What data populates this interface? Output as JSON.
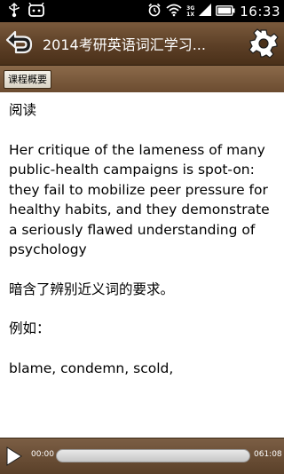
{
  "status_bar": {
    "time": "16:33",
    "network_top": "3G",
    "network_bottom": "1X",
    "icons": [
      "usb-icon",
      "notification-icon",
      "alarm-icon",
      "wifi-icon",
      "signal-icon",
      "battery-icon"
    ]
  },
  "header": {
    "title": "2014考研英语词汇学习...",
    "back_icon": "back-arrow-icon",
    "settings_icon": "gear-icon"
  },
  "tab": {
    "label": "课程概要"
  },
  "content": {
    "heading": "阅读",
    "body": "Her critique of the lameness of many public-health campaigns is spot-on: they fail to mobilize peer pressure for healthy habits, and they demonstrate a seriously flawed understanding of psychology",
    "note": "暗含了辨别近义词的要求。",
    "example_label": "例如：",
    "words": "blame, condemn, scold,"
  },
  "player": {
    "current_time": "00:00",
    "total_time": "061:08",
    "progress": 0,
    "accent_color": "#8fc04a"
  }
}
